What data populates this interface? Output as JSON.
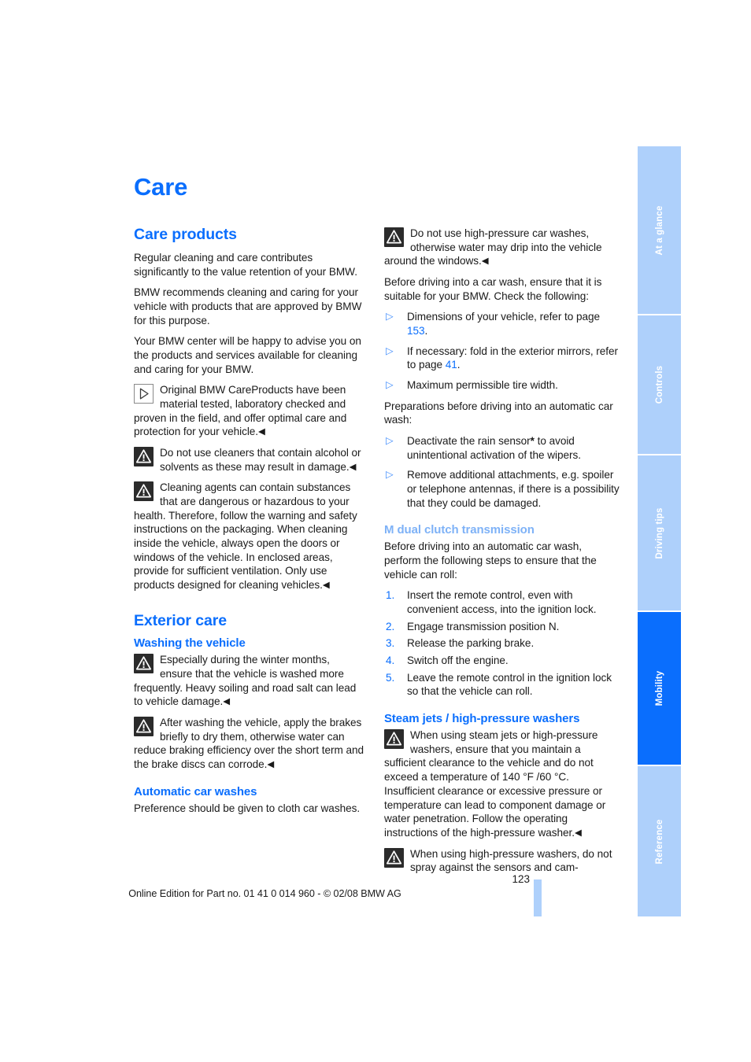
{
  "document": {
    "title": "Care",
    "page_number": "123",
    "footer_line": "Online Edition for Part no. 01 41 0 014 960 - © 02/08 BMW AG"
  },
  "colors": {
    "heading_blue": "#0a6efd",
    "light_heading_blue": "#7eb2f7",
    "tab_blue": "#aed0fb",
    "tab_active_blue": "#0a6efd"
  },
  "left_column": {
    "section_care_products": {
      "heading": "Care products",
      "paragraphs": [
        "Regular cleaning and care contributes significantly to the value retention of your BMW.",
        "BMW recommends cleaning and caring for your vehicle with products that are approved by BMW for this purpose.",
        "Your BMW center will be happy to advise you on the products and services available for cleaning and caring for your BMW."
      ],
      "note": {
        "icon": "note-triangle-icon",
        "text": "Original BMW CareProducts have been material tested, laboratory checked and proven in the field, and offer optimal care and protection for your vehicle.",
        "endmark": "◀"
      },
      "warnings": [
        {
          "icon": "warning-triangle-icon",
          "text": "Do not use cleaners that contain alcohol or solvents as these may result in damage.",
          "endmark": "◀"
        },
        {
          "icon": "warning-triangle-icon",
          "text": "Cleaning agents can contain substances that are dangerous or hazardous to your health. Therefore, follow the warning and safety instructions on the packaging. When cleaning inside the vehicle, always open the doors or windows of the vehicle. In enclosed areas, provide for sufficient ventilation. Only use products designed for cleaning vehicles.",
          "endmark": "◀"
        }
      ]
    },
    "section_exterior_care": {
      "heading": "Exterior care",
      "subsection_washing": {
        "heading": "Washing the vehicle",
        "warnings": [
          {
            "icon": "warning-triangle-icon",
            "text": "Especially during the winter months, ensure that the vehicle is washed more frequently. Heavy soiling and road salt can lead to vehicle damage.",
            "endmark": "◀"
          },
          {
            "icon": "warning-triangle-icon",
            "text": "After washing the vehicle, apply the brakes briefly to dry them, otherwise water can reduce braking efficiency over the short term and the brake discs can corrode.",
            "endmark": "◀"
          }
        ]
      },
      "subsection_automatic": {
        "heading": "Automatic car washes",
        "paragraph": "Preference should be given to cloth car washes."
      }
    }
  },
  "right_column": {
    "warning_top": {
      "icon": "warning-triangle-icon",
      "text": "Do not use high-pressure car washes, otherwise water may drip into the vehicle around the windows.",
      "endmark": "◀"
    },
    "intro_paragraph": "Before driving into a car wash, ensure that it is suitable for your BMW. Check the following:",
    "check_list": [
      {
        "text_before": "Dimensions of your vehicle, refer to page ",
        "page_ref": "153",
        "text_after": "."
      },
      {
        "text_before": "If necessary: fold in the exterior mirrors, refer to page ",
        "page_ref": "41",
        "text_after": "."
      },
      {
        "text_before": "Maximum permissible tire width.",
        "page_ref": "",
        "text_after": ""
      }
    ],
    "prep_paragraph": "Preparations before driving into an automatic car wash:",
    "prep_list": [
      {
        "text_before": "Deactivate the rain sensor",
        "asterisk": "*",
        "text_after": " to avoid unintentional activation of the wipers."
      },
      {
        "text_before": "Remove additional attachments, e.g. spoiler or telephone antennas, if there is a possibility that they could be damaged.",
        "asterisk": "",
        "text_after": ""
      }
    ],
    "section_m_dct": {
      "heading": "M dual clutch transmission",
      "paragraph": "Before driving into an automatic car wash, perform the following steps to ensure that the vehicle can roll:",
      "steps": [
        {
          "number": "1.",
          "text": "Insert the remote control, even with convenient access, into the ignition lock."
        },
        {
          "number": "2.",
          "text": "Engage transmission position N."
        },
        {
          "number": "3.",
          "text": "Release the parking brake."
        },
        {
          "number": "4.",
          "text": "Switch off the engine."
        },
        {
          "number": "5.",
          "text": "Leave the remote control in the ignition lock so that the vehicle can roll."
        }
      ]
    },
    "section_steam": {
      "heading": "Steam jets / high-pressure washers",
      "warning_one": {
        "icon": "warning-triangle-icon",
        "text": "When using steam jets or high-pressure washers, ensure that you maintain a sufficient clearance to the vehicle and do not exceed a temperature of 140 °F /60 °C."
      },
      "continuation": {
        "text": "Insufficient clearance or excessive pressure or temperature can lead to component damage or water penetration. Follow the operating instructions of the high-pressure washer.",
        "endmark": "◀"
      },
      "warning_two": {
        "icon": "warning-triangle-icon",
        "text": "When using high-pressure washers, do not spray against the sensors and cam-"
      }
    }
  },
  "tabs": [
    {
      "label": "At a glance",
      "active": false
    },
    {
      "label": "Controls",
      "active": false
    },
    {
      "label": "Driving tips",
      "active": false
    },
    {
      "label": "Mobility",
      "active": true
    },
    {
      "label": "Reference",
      "active": false
    }
  ]
}
